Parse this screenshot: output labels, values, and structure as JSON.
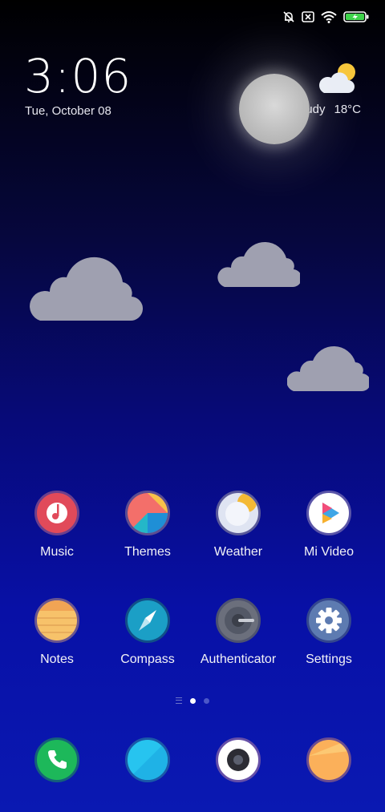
{
  "status_bar": {
    "icons": [
      "alarm-off-icon",
      "no-sim-icon",
      "wifi-icon",
      "battery-charging-icon"
    ]
  },
  "clock": {
    "time": "3:06",
    "date": "Tue, October 08"
  },
  "weather": {
    "condition": "Cloudy",
    "temperature": "18°C",
    "icon": "partly-cloudy-icon"
  },
  "apps": [
    {
      "label": "Music",
      "icon": "music-icon"
    },
    {
      "label": "Themes",
      "icon": "themes-icon"
    },
    {
      "label": "Weather",
      "icon": "weather-icon"
    },
    {
      "label": "Mi Video",
      "icon": "play-icon"
    },
    {
      "label": "Notes",
      "icon": "notes-icon"
    },
    {
      "label": "Compass",
      "icon": "compass-icon"
    },
    {
      "label": "Authenticator",
      "icon": "authenticator-icon"
    },
    {
      "label": "Settings",
      "icon": "gear-icon"
    }
  ],
  "pages": {
    "count": 2,
    "current": 1
  },
  "dock": [
    {
      "icon": "phone-icon"
    },
    {
      "icon": "messaging-icon"
    },
    {
      "icon": "camera-icon"
    },
    {
      "icon": "browser-icon"
    }
  ],
  "colors": {
    "cloud": "#9fa0b0",
    "accent_green": "#1db85a",
    "accent_cyan": "#27c4ef"
  }
}
